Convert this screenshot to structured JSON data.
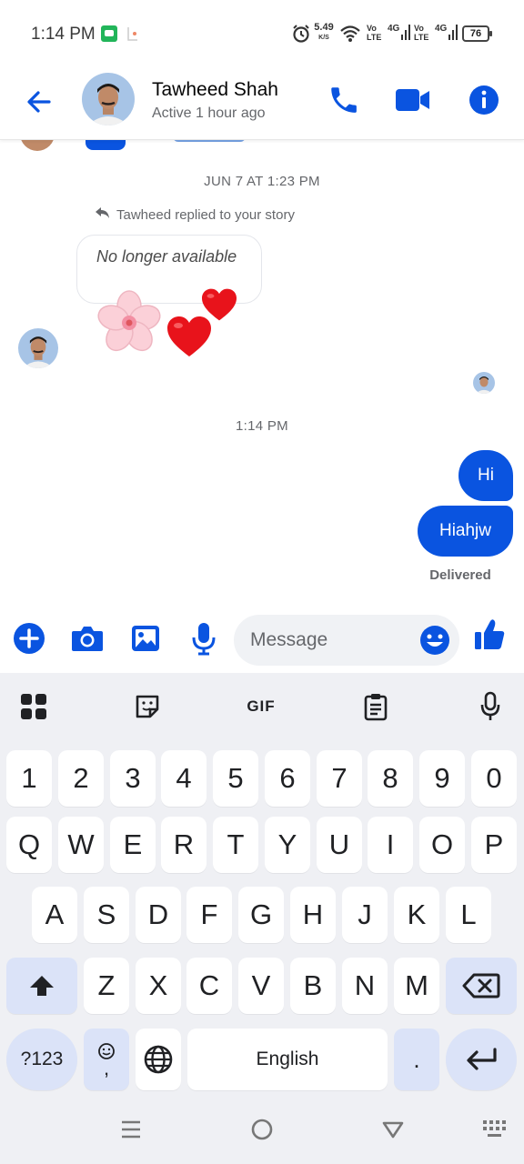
{
  "status_bar": {
    "time": "1:14 PM",
    "net_speed": "5.49",
    "net_speed_unit": "K/S",
    "sim1_top": "Vo",
    "sim1_bottom": "LTE",
    "sim1_gen": "4G",
    "sim2_top": "Vo",
    "sim2_bottom": "LTE",
    "sim2_gen": "4G",
    "battery": "76"
  },
  "header": {
    "contact_name": "Tawheed Shah",
    "contact_status": "Active 1 hour ago"
  },
  "chat": {
    "date_divider": "JUN 7 AT 1:23 PM",
    "reply_note": "Tawheed replied to your story",
    "story_text": "No longer available",
    "time_divider": "1:14 PM",
    "messages": [
      {
        "text": "Hi"
      },
      {
        "text": "Hiahjw"
      }
    ],
    "delivered": "Delivered"
  },
  "composer": {
    "placeholder": "Message"
  },
  "keyboard": {
    "gif_label": "GIF",
    "row_numbers": [
      "1",
      "2",
      "3",
      "4",
      "5",
      "6",
      "7",
      "8",
      "9",
      "0"
    ],
    "row_q": [
      "Q",
      "W",
      "E",
      "R",
      "T",
      "Y",
      "U",
      "I",
      "O",
      "P"
    ],
    "row_a": [
      "A",
      "S",
      "D",
      "F",
      "G",
      "H",
      "J",
      "K",
      "L"
    ],
    "row_z": [
      "Z",
      "X",
      "C",
      "V",
      "B",
      "N",
      "M"
    ],
    "symbols_key": "?123",
    "comma_key": ",",
    "space_key": "English",
    "period_key": "."
  },
  "colors": {
    "accent": "#0a54e0",
    "keyboard_bg": "#eff0f4",
    "mod_key_bg": "#dbe3f8"
  }
}
